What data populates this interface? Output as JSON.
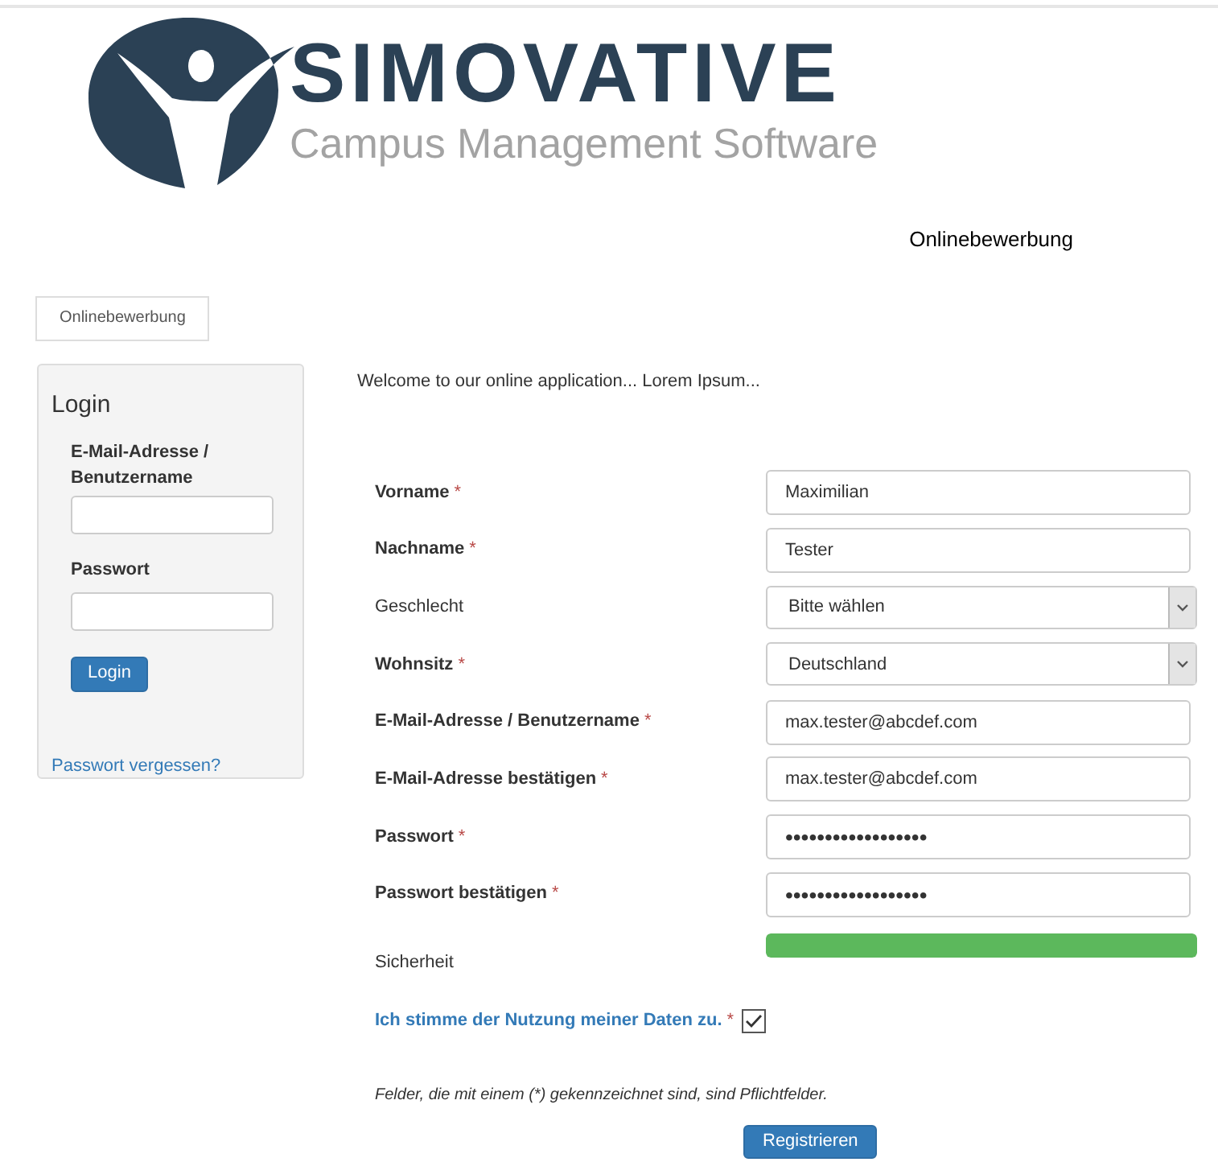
{
  "logo": {
    "name": "SIMOVATIVE",
    "tagline": "Campus Management Software"
  },
  "header_link": "Onlinebewerbung",
  "tabs": [
    {
      "label": "Onlinebewerbung",
      "selected": true
    }
  ],
  "login": {
    "title": "Login",
    "username_label": "E-Mail-Adresse / Benutzername",
    "password_label": "Passwort",
    "button": "Login",
    "forgot_link": "Passwort vergessen?"
  },
  "welcome": "Welcome to our online application... Lorem Ipsum...",
  "fields": [
    {
      "label": "Vorname",
      "required": true,
      "mark": "*",
      "kind": "text",
      "value": "Maximilian"
    },
    {
      "label": "Nachname",
      "required": true,
      "mark": "*",
      "kind": "text",
      "value": "Tester"
    },
    {
      "label": "Geschlecht",
      "required": false,
      "kind": "select",
      "value": "Bitte wählen"
    },
    {
      "label": "Wohnsitz",
      "required": true,
      "mark": "*",
      "kind": "select",
      "value": "Deutschland"
    },
    {
      "label": "E-Mail-Adresse / Benutzername",
      "required": true,
      "mark": "*",
      "kind": "text",
      "value": "max.tester@abcdef.com"
    },
    {
      "label": "E-Mail-Adresse bestätigen",
      "required": true,
      "mark": "*",
      "kind": "text",
      "value": "max.tester@abcdef.com"
    },
    {
      "label": "Passwort",
      "required": true,
      "mark": "*",
      "kind": "password",
      "value": "••••••••••••••••••"
    },
    {
      "label": "Passwort bestätigen",
      "required": true,
      "mark": "*",
      "kind": "password",
      "value": "••••••••••••••••••"
    }
  ],
  "strength": {
    "label": "Sicherheit",
    "level": 1
  },
  "consent": {
    "label": "Ich stimme der Nutzung meiner Daten zu.",
    "mark": "*",
    "checked": true
  },
  "footnote": "Felder, die mit einem (*) gekennzeichnet sind, sind Pflichtfelder.",
  "submit": "Registrieren"
}
